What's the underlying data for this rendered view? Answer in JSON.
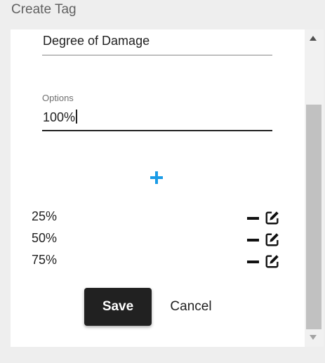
{
  "dialog": {
    "title": "Create Tag"
  },
  "form": {
    "name_value": "Degree of Damage",
    "options_label": "Options",
    "options_value": "100%"
  },
  "options": [
    {
      "label": "25%"
    },
    {
      "label": "50%"
    },
    {
      "label": "75%"
    }
  ],
  "actions": {
    "save_label": "Save",
    "cancel_label": "Cancel"
  },
  "icons": {
    "add": "plus-icon",
    "remove": "minus-icon",
    "edit": "edit-icon"
  },
  "colors": {
    "accent": "#1a9be6",
    "save_bg": "#212121",
    "text": "#212121"
  }
}
